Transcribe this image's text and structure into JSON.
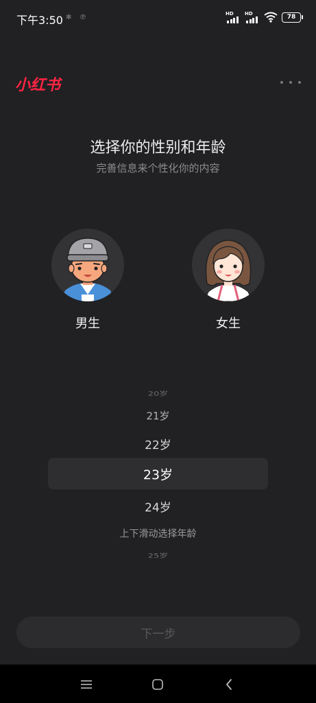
{
  "status_bar": {
    "time": "下午3:50",
    "battery": "78",
    "signal_1_label": "HD",
    "signal_2_label": "HD"
  },
  "header": {
    "logo_text": "小红书",
    "logo_color": "#ff2442",
    "more_icon": "more-horizontal-icon"
  },
  "main": {
    "title": "选择你的性别和年龄",
    "subtitle": "完善信息来个性化你的内容"
  },
  "gender": {
    "male_label": "男生",
    "female_label": "女生"
  },
  "age_picker": {
    "ages": [
      "20岁",
      "21岁",
      "22岁",
      "23岁",
      "24岁",
      "25岁"
    ],
    "selected": "23岁",
    "hint": "上下滑动选择年龄"
  },
  "footer": {
    "next_label": "下一步"
  },
  "nav_bar": {
    "menu_icon": "menu-icon",
    "home_icon": "home-icon",
    "back_icon": "back-icon"
  }
}
